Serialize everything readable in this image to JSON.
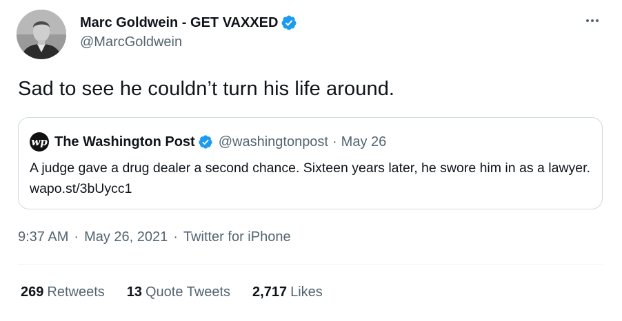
{
  "author": {
    "display_name": "Marc Goldwein - GET VAXXED",
    "handle": "@MarcGoldwein",
    "verified": true
  },
  "tweet": {
    "text": "Sad to see he couldn’t turn his life around."
  },
  "quoted_tweet": {
    "logo_text": "wp",
    "display_name": "The Washington Post",
    "handle": "@washingtonpost",
    "separator": "·",
    "date": "May 26",
    "text": "A judge gave a drug dealer a second chance. Sixteen years later, he swore him in as a lawyer. wapo.st/3bUycc1"
  },
  "meta": {
    "time": "9:37 AM",
    "separator": "·",
    "date": "May 26, 2021",
    "source": "Twitter for iPhone"
  },
  "stats": {
    "retweets_count": "269",
    "retweets_label": "Retweets",
    "quotes_count": "13",
    "quotes_label": "Quote Tweets",
    "likes_count": "2,717",
    "likes_label": "Likes"
  },
  "colors": {
    "verified_blue": "#1d9bf0",
    "secondary_text": "#536471",
    "border": "#cfd9de"
  },
  "icons": {
    "verified": "verified-badge-icon",
    "more": "more-options-icon"
  }
}
